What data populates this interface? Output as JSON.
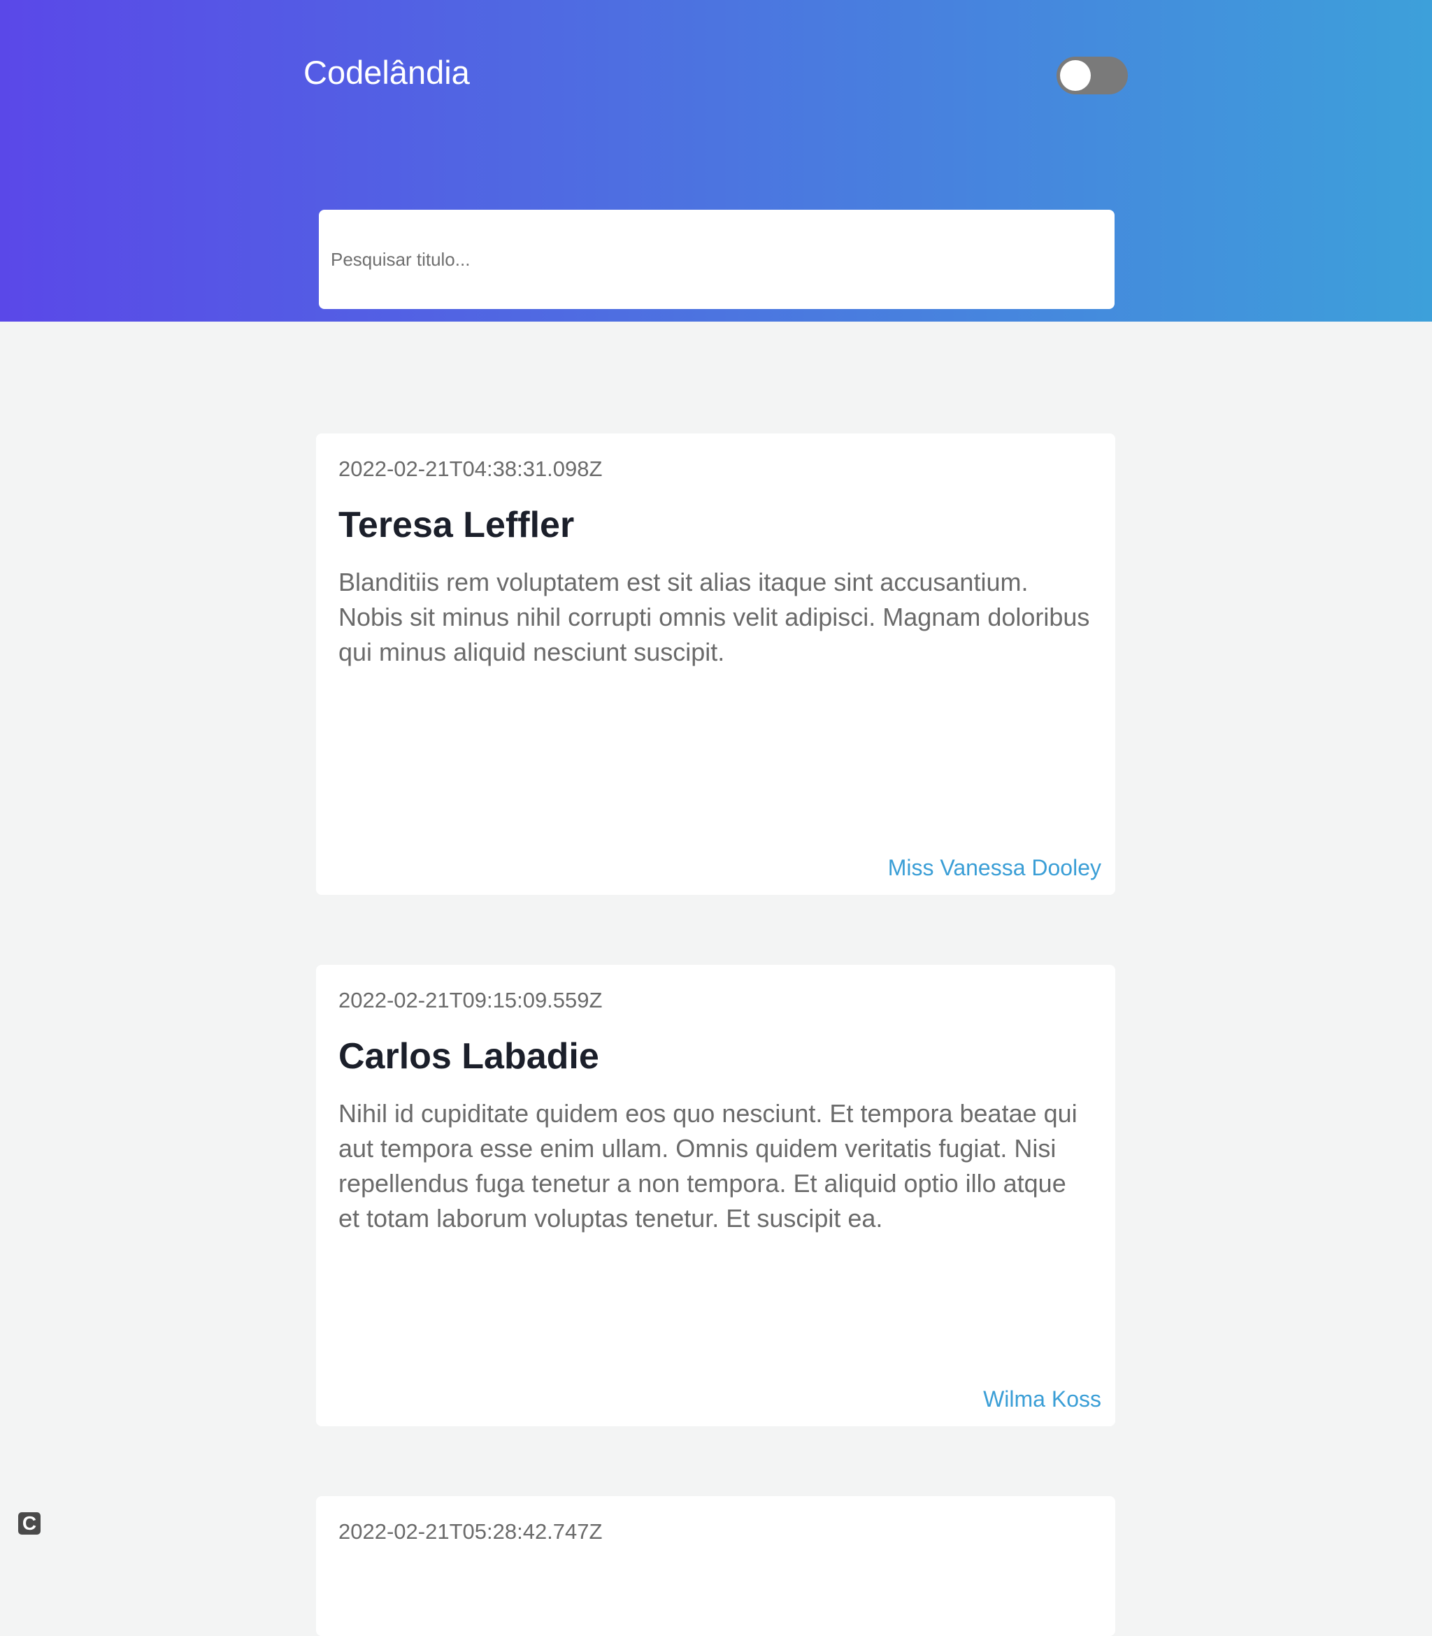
{
  "header": {
    "brand": "Codelândia",
    "search_placeholder": "Pesquisar titulo..."
  },
  "posts": [
    {
      "date": "2022-02-21T04:38:31.098Z",
      "title": "Teresa Leffler",
      "body": "Blanditiis rem voluptatem est sit alias itaque sint accusantium. Nobis sit minus nihil corrupti omnis velit adipisci. Magnam doloribus qui minus aliquid nesciunt suscipit.",
      "author": "Miss Vanessa Dooley"
    },
    {
      "date": "2022-02-21T09:15:09.559Z",
      "title": "Carlos Labadie",
      "body": "Nihil id cupiditate quidem eos quo nesciunt. Et tempora beatae qui aut tempora esse enim ullam. Omnis quidem veritatis fugiat. Nisi repellendus fuga tenetur a non tempora. Et aliquid optio illo atque et totam laborum voluptas tenetur. Et suscipit ea.",
      "author": "Wilma Koss"
    },
    {
      "date": "2022-02-21T05:28:42.747Z"
    }
  ],
  "theme": {
    "accent": "#3a9ed6",
    "toggle_track": "#7a7a7a",
    "gradient_start": "#5a48e8",
    "gradient_end": "#3da0da"
  },
  "icons": {
    "theme_toggle": "toggle-switch",
    "corner": "c-logo-icon",
    "corner_glyph": "C"
  }
}
